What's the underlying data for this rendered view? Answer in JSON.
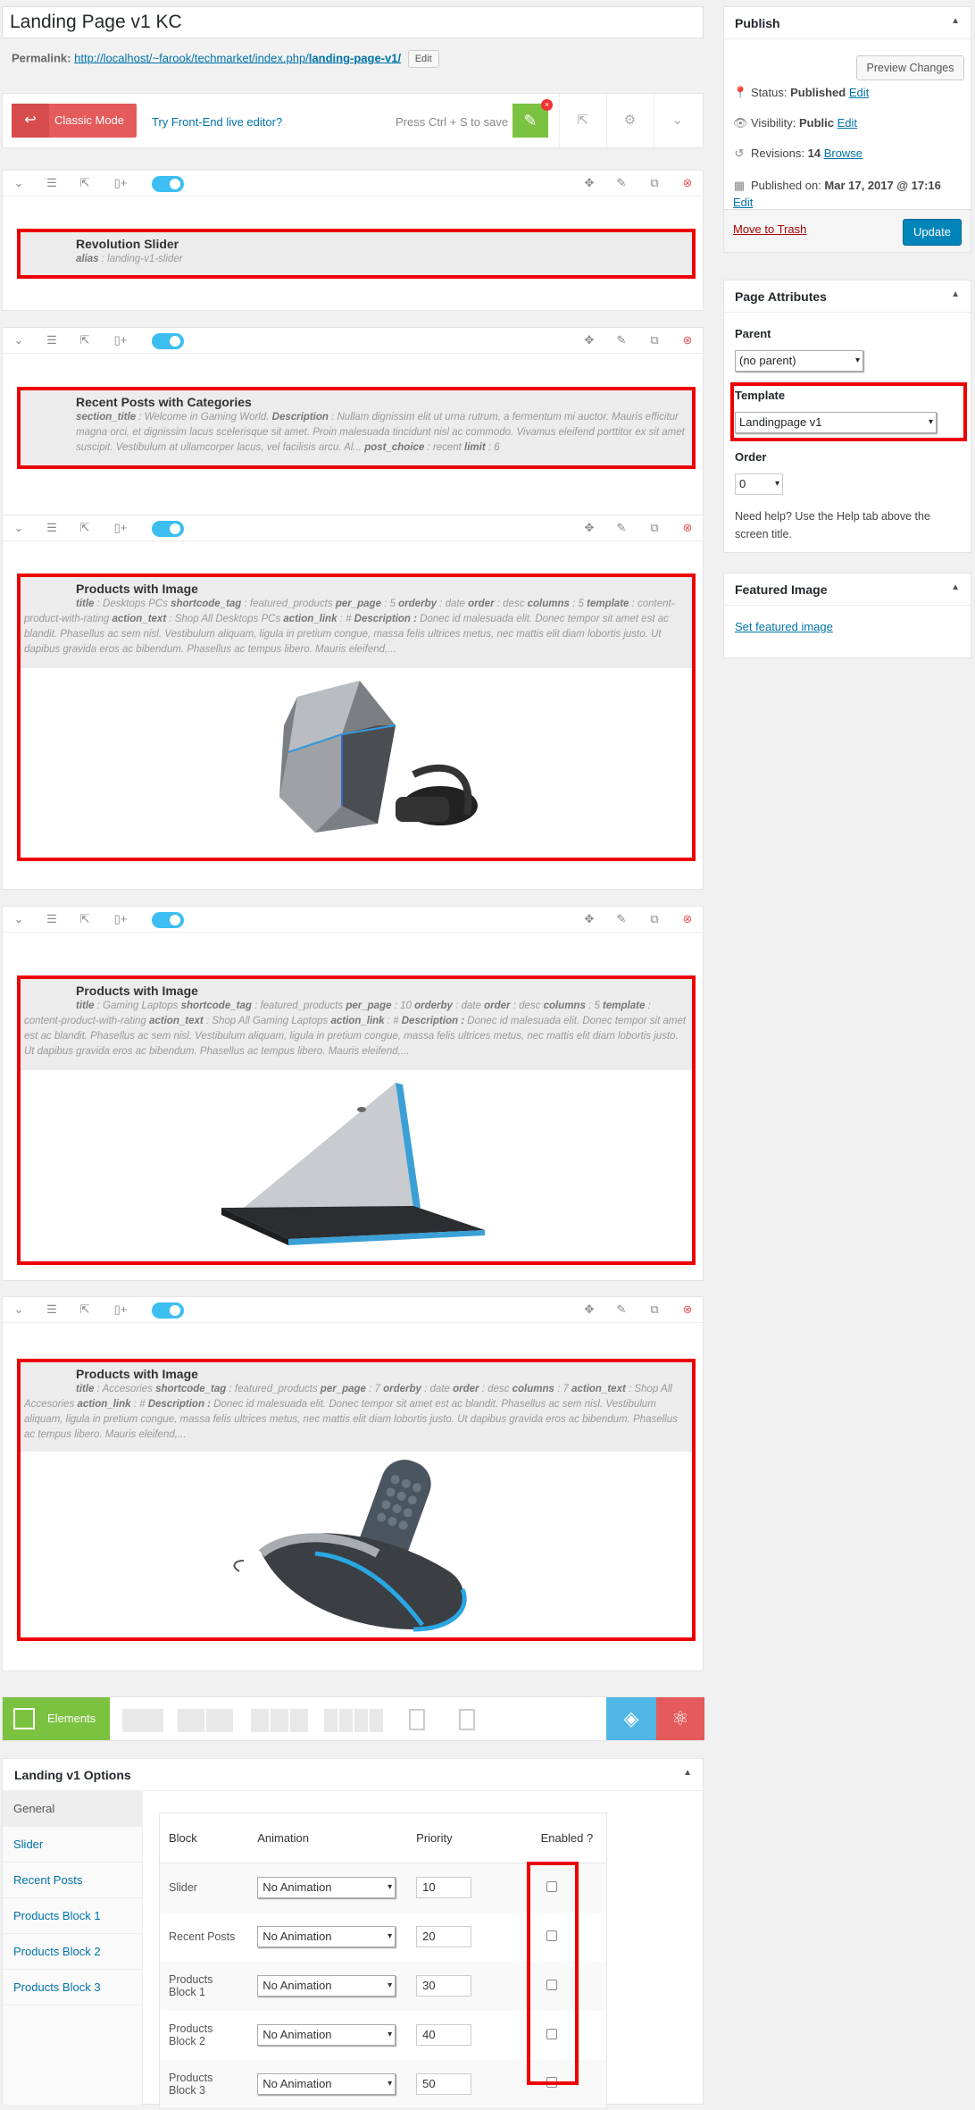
{
  "post": {
    "title": "Landing Page v1 KC",
    "permalink_label": "Permalink:",
    "permalink_base": "http://localhost/~farook/techmarket/index.php/",
    "permalink_slug": "landing-page-v1/",
    "edit_label": "Edit"
  },
  "toolbar": {
    "classic_mode": "Classic Mode",
    "frontend_link": "Try Front-End live editor?",
    "save_hint": "Press Ctrl + S to save"
  },
  "rows": [
    {
      "title": "Revolution Slider",
      "desc_html": "<b>alias</b> : landing-v1-slider",
      "image": "none"
    },
    {
      "title": "Recent Posts with Categories",
      "desc_html": "<b>section_title</b> : Welcome in Gaming World. <b>Description</b> : Nullam dignissim elit ut urna rutrum, a fermentum mi auctor. Mauris efficitur magna orci, et dignissim lacus scelerisque sit amet. Proin malesuada tincidunt nisl ac commodo. Vivamus eleifend porttitor ex sit amet suscipit. Vestibulum at ullamcorper lacus, vel facilisis arcu. Al... <b>post_choice</b> : recent <b>limit</b> : 6",
      "image": "none"
    },
    {
      "title": "Products with Image",
      "desc_html": "<b>title</b> : Desktops PCs <b>shortcode_tag</b> : featured_products <b>per_page</b> : 5 <b>orderby</b> : date <b>order</b> : desc <b>columns</b> : 5 <b>template</b> : content-product-with-rating <b>action_text</b> : Shop All Desktops PCs <b>action_link</b> : # <b>Description :</b> Donec id malesuada elit. Donec tempor sit amet est ac blandit. Phasellus ac sem nisl. Vestibulum aliquam, ligula in pretium congue, massa felis ultrices metus, nec mattis elit diam lobortis justo. Ut dapibus gravida eros ac bibendum. Phasellus ac tempus libero. Mauris eleifend,...",
      "image": "desktop-pc-with-vr-headset"
    },
    {
      "title": "Products with Image",
      "desc_html": "<b>title</b> : Gaming Laptops <b>shortcode_tag</b> : featured_products <b>per_page</b> : 10 <b>orderby</b> : date <b>order</b> : desc <b>columns</b> : 5 <b>template</b> : content-product-with-rating <b>action_text</b> : Shop All Gaming Laptops <b>action_link</b> : # <b>Description :</b> Donec id malesuada elit. Donec tempor sit amet est ac blandit. Phasellus ac sem nisl. Vestibulum aliquam, ligula in pretium congue, massa felis ultrices metus, nec mattis elit diam lobortis justo. Ut dapibus gravida eros ac bibendum. Phasellus ac tempus libero. Mauris eleifend,...",
      "image": "gaming-laptop"
    },
    {
      "title": "Products with Image",
      "desc_html": "<b>title</b> : Accesories <b>shortcode_tag</b> : featured_products <b>per_page</b> : 7 <b>orderby</b> : date <b>order</b> : desc <b>columns</b> : 7 <b>action_text</b> : Shop All Accesories <b>action_link</b> : # <b>Description :</b> Donec id malesuada elit. Donec tempor sit amet est ac blandit. Phasellus ac sem nisl. Vestibulum aliquam, ligula in pretium congue, massa felis ultrices metus, nec mattis elit diam lobortis justo. Ut dapibus gravida eros ac bibendum. Phasellus ac tempus libero. Mauris eleifend,...",
      "image": "gaming-mouse-and-keyboard"
    }
  ],
  "element_bar": {
    "elements_label": "Elements"
  },
  "options": {
    "title": "Landing v1 Options",
    "tabs": [
      "General",
      "Slider",
      "Recent Posts",
      "Products Block 1",
      "Products Block 2",
      "Products Block 3"
    ],
    "headers": [
      "Block",
      "Animation",
      "Priority",
      "Enabled ?"
    ],
    "rows": [
      {
        "block": "Slider",
        "animation": "No Animation",
        "priority": "10"
      },
      {
        "block": "Recent Posts",
        "animation": "No Animation",
        "priority": "20"
      },
      {
        "block": "Products Block 1",
        "animation": "No Animation",
        "priority": "30"
      },
      {
        "block": "Products Block 2",
        "animation": "No Animation",
        "priority": "40"
      },
      {
        "block": "Products Block 3",
        "animation": "No Animation",
        "priority": "50"
      }
    ]
  },
  "publish": {
    "title": "Publish",
    "preview": "Preview Changes",
    "status_label": "Status:",
    "status_value": "Published",
    "visibility_label": "Visibility:",
    "visibility_value": "Public",
    "revisions_label": "Revisions:",
    "revisions_value": "14",
    "browse": "Browse",
    "published_label": "Published on:",
    "published_value": "Mar 17, 2017 @ 17:16",
    "edit": "Edit",
    "trash": "Move to Trash",
    "update": "Update"
  },
  "attributes": {
    "title": "Page Attributes",
    "parent_label": "Parent",
    "parent_value": "(no parent)",
    "template_label": "Template",
    "template_value": "Landingpage v1",
    "order_label": "Order",
    "order_value": "0",
    "help": "Need help? Use the Help tab above the screen title."
  },
  "featured": {
    "title": "Featured Image",
    "link": "Set featured image"
  },
  "colors": {
    "highlight": "#ee0000",
    "accent_green": "#7cc241",
    "accent_blue": "#0085ba",
    "classic_red": "#e55a5a"
  }
}
